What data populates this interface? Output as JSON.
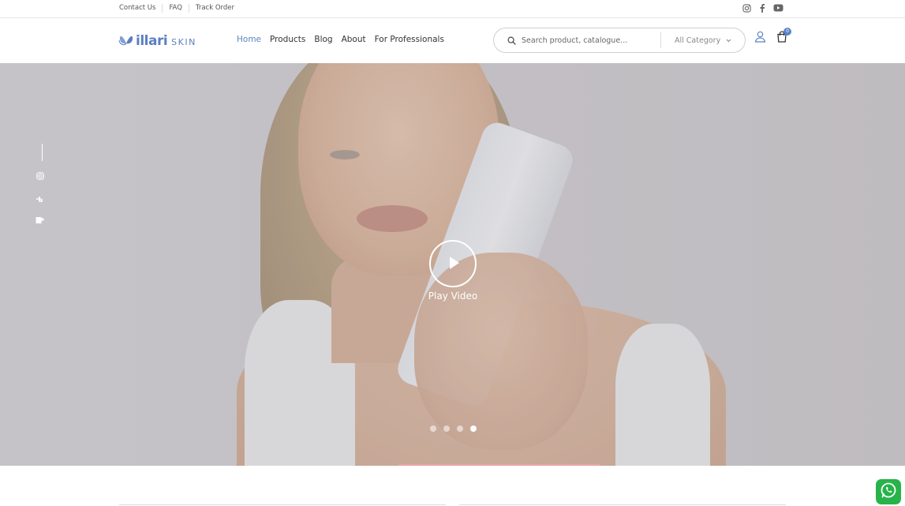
{
  "topbar": {
    "links": [
      "Contact Us",
      "FAQ",
      "Track Order"
    ],
    "social_icons": [
      "instagram-icon",
      "facebook-icon",
      "youtube-icon"
    ]
  },
  "header": {
    "logo": {
      "brand": "illari",
      "suffix": "SKIN"
    },
    "nav": [
      {
        "label": "Home",
        "active": true
      },
      {
        "label": "Products",
        "active": false
      },
      {
        "label": "Blog",
        "active": false
      },
      {
        "label": "About",
        "active": false
      },
      {
        "label": "For Professionals",
        "active": false
      }
    ],
    "search": {
      "placeholder": "Search product, catalogue...",
      "category": "All Category"
    },
    "cart_count": "0"
  },
  "hero": {
    "play_label": "Play Video",
    "slides": 4,
    "active_slide": 4,
    "side_social_icons": [
      "instagram-icon",
      "facebook-icon",
      "youtube-icon"
    ]
  },
  "colors": {
    "accent": "#5b84c6",
    "whatsapp": "#27b34a"
  }
}
